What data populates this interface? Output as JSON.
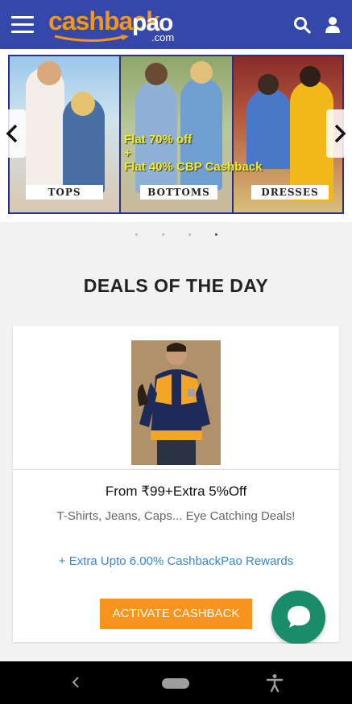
{
  "header": {
    "logo_cashback": "cashback",
    "logo_pao": "pao",
    "logo_com": ".com",
    "icons": [
      "menu-icon",
      "search-icon",
      "user-icon"
    ]
  },
  "banner": {
    "labels": [
      "TOPS",
      "BOTTOMS",
      "DRESSES"
    ],
    "promo_line1": "Flat 70% off",
    "promo_line2": "+",
    "promo_line3": "Flat 40% CBP Cashback",
    "slide_count": 4
  },
  "deals": {
    "title": "DEALS OF THE DAY",
    "card": {
      "title": "From ₹99+Extra 5%Off",
      "description": "T-Shirts, Jeans, Caps... Eye Catching Deals!",
      "reward": "+ Extra Upto 6.00% CashbackPao Rewards",
      "button": "ACTIVATE CASHBACK"
    }
  },
  "colors": {
    "header": "#3348a8",
    "accent": "#f7941d",
    "reward_link": "#3a86c8",
    "chat": "#1a8c6a"
  }
}
